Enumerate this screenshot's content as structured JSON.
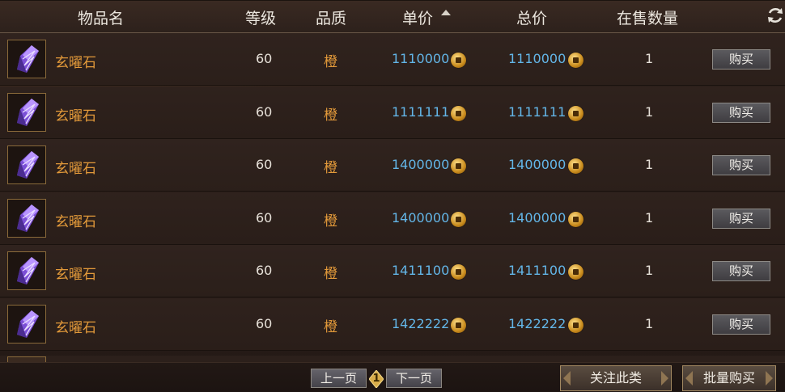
{
  "headers": {
    "name": "物品名",
    "level": "等级",
    "quality": "品质",
    "unit_price": "单价",
    "total_price": "总价",
    "on_sale": "在售数量"
  },
  "rows": [
    {
      "name": "玄曜石",
      "level": "60",
      "quality": "橙",
      "unit_price": "1110000",
      "total_price": "1110000",
      "count": "1",
      "buy": "购买"
    },
    {
      "name": "玄曜石",
      "level": "60",
      "quality": "橙",
      "unit_price": "1111111",
      "total_price": "1111111",
      "count": "1",
      "buy": "购买"
    },
    {
      "name": "玄曜石",
      "level": "60",
      "quality": "橙",
      "unit_price": "1400000",
      "total_price": "1400000",
      "count": "1",
      "buy": "购买"
    },
    {
      "name": "玄曜石",
      "level": "60",
      "quality": "橙",
      "unit_price": "1400000",
      "total_price": "1400000",
      "count": "1",
      "buy": "购买"
    },
    {
      "name": "玄曜石",
      "level": "60",
      "quality": "橙",
      "unit_price": "1411100",
      "total_price": "1411100",
      "count": "1",
      "buy": "购买"
    },
    {
      "name": "玄曜石",
      "level": "60",
      "quality": "橙",
      "unit_price": "1422222",
      "total_price": "1422222",
      "count": "1",
      "buy": "购买"
    }
  ],
  "pagination": {
    "prev": "上一页",
    "current": "1",
    "next": "下一页"
  },
  "actions": {
    "follow": "关注此类",
    "bulk_buy": "批量购买"
  },
  "icons": {
    "sort": "sort-ascending-icon",
    "refresh": "refresh-icon",
    "currency": "coin-icon",
    "item": "purple-crystal-icon"
  },
  "colors": {
    "item_name": "#e39a3a",
    "price": "#63b6e8",
    "quality_orange": "#e39a3a"
  }
}
